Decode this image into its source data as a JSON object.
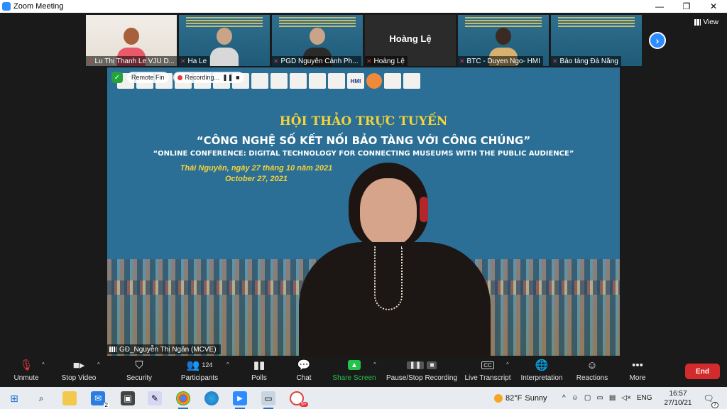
{
  "window": {
    "title": "Zoom Meeting",
    "minimize": "—",
    "maximize": "❐",
    "close": "✕"
  },
  "view_button": {
    "label": "View"
  },
  "gallery": [
    {
      "name": "Lu Thị Thanh Le VJU D...",
      "kind": "face",
      "muted": true
    },
    {
      "name": "Ha Le",
      "kind": "slide",
      "muted": true
    },
    {
      "name": "PGD Nguyễn Cảnh Ph...",
      "kind": "slide",
      "muted": true
    },
    {
      "name": "Hoàng Lệ",
      "kind": "dark",
      "big_name": "Hoàng Lệ",
      "muted": true
    },
    {
      "name": "BTC - Duyen Ngo- HMI",
      "kind": "slide",
      "muted": true
    },
    {
      "name": "Bảo tàng Đà Nẵng",
      "kind": "slide",
      "muted": true
    }
  ],
  "next_icon": "›",
  "speaker": {
    "name": "GĐ_Nguyễn Thị Ngân (MCVE)",
    "remote_label": "Remote Fin",
    "recording_label": "Recording..."
  },
  "slide": {
    "line1": "HỘI THẢO TRỰC TUYẾN",
    "line2": "“CÔNG NGHỆ SỐ KẾT NỐI BẢO TÀNG VỚI CÔNG CHÚNG”",
    "line3": "“ONLINE CONFERENCE: DIGITAL TECHNOLOGY FOR CONNECTING MUSEUMS WITH THE PUBLIC AUDIENCE”",
    "line4": "Thái Nguyên, ngày 27 tháng 10 năm 2021",
    "line5": "October 27, 2021",
    "logo_text": "HMI"
  },
  "toolbar": {
    "unmute": "Unmute",
    "stop_video": "Stop Video",
    "security": "Security",
    "participants": "Participants",
    "participant_count": "124",
    "polls": "Polls",
    "chat": "Chat",
    "share_screen": "Share Screen",
    "pause_stop_recording": "Pause/Stop Recording",
    "live_transcript": "Live Transcript",
    "cc_label": "CC",
    "interpretation": "Interpretation",
    "reactions": "Reactions",
    "more": "More",
    "end": "End"
  },
  "taskbar": {
    "mail_badge": "2",
    "badge_app": "5+",
    "weather_temp": "82°F",
    "weather_text": "Sunny",
    "language": "ENG",
    "time": "16:57",
    "date": "27/10/21",
    "notification_count": "7"
  }
}
